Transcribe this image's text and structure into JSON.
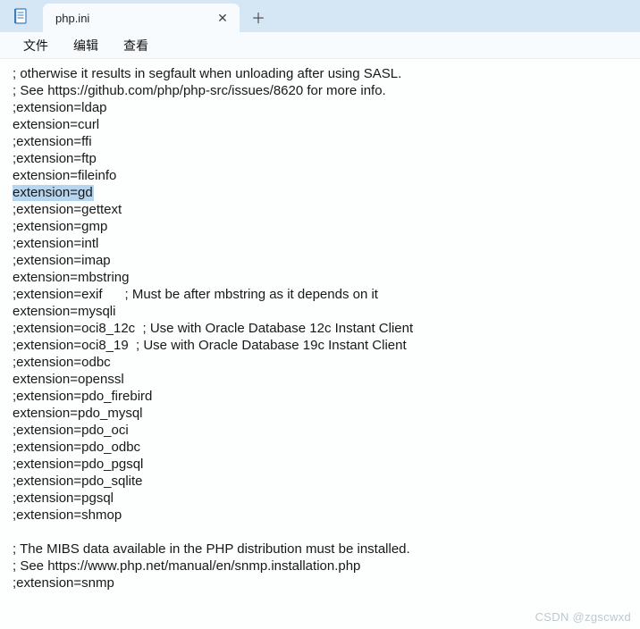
{
  "tab": {
    "title": "php.ini",
    "close_glyph": "✕",
    "newtab_glyph": "＋"
  },
  "menu": {
    "file": "文件",
    "edit": "编辑",
    "view": "查看"
  },
  "editor": {
    "highlighted_index": 8,
    "lines": [
      "; otherwise it results in segfault when unloading after using SASL.",
      "; See https://github.com/php/php-src/issues/8620 for more info.",
      ";extension=ldap",
      "extension=curl",
      ";extension=ffi",
      ";extension=ftp",
      "extension=fileinfo",
      "extension=gd",
      ";extension=gettext",
      ";extension=gmp",
      ";extension=intl",
      ";extension=imap",
      "extension=mbstring",
      ";extension=exif      ; Must be after mbstring as it depends on it",
      "extension=mysqli",
      ";extension=oci8_12c  ; Use with Oracle Database 12c Instant Client",
      ";extension=oci8_19  ; Use with Oracle Database 19c Instant Client",
      ";extension=odbc",
      "extension=openssl",
      ";extension=pdo_firebird",
      "extension=pdo_mysql",
      ";extension=pdo_oci",
      ";extension=pdo_odbc",
      ";extension=pdo_pgsql",
      ";extension=pdo_sqlite",
      ";extension=pgsql",
      ";extension=shmop",
      "",
      "; The MIBS data available in the PHP distribution must be installed.",
      "; See https://www.php.net/manual/en/snmp.installation.php",
      ";extension=snmp"
    ]
  },
  "watermark": "CSDN @zgscwxd",
  "icons": {
    "app": "notepad-icon"
  }
}
